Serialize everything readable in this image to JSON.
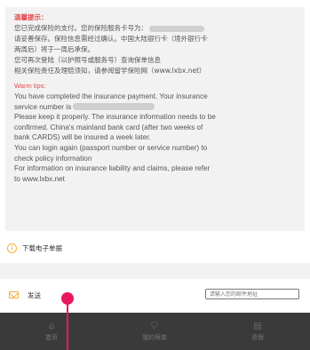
{
  "tips_cn": {
    "title": "温馨提示：",
    "lines": [
      "您已完成保险的支付。您的保险服务卡号为：",
      "请妥善保存。保险信息需经过确认。中国大陆银行卡（境外银行卡",
      "两周后）将于一周后承保。",
      "您可再次登陆（以护照号或服务号）查询保单信息",
      "相关保险责任及理赔须知，请参阅留学保险网（www.lxbx.net）"
    ]
  },
  "tips_en": {
    "title": "Warm tips:",
    "lines": [
      "You have completed the insurance payment. Your insurance",
      "service number is",
      "Please keep it properly. The insurance information needs to be",
      "confirmed. China's mainland bank card (after two weeks of",
      "bank CARDS) will be insured a week later.",
      "You can login again (passport number or service number) to",
      "check policy information",
      "For information on insurance liability and claims, please refer",
      "to www.lxbx.net"
    ]
  },
  "download": {
    "icon": "download-icon",
    "label": "下载电子单据"
  },
  "send": {
    "icon": "mail-icon",
    "label": "发送",
    "placeholder": "请输入您的邮件地址",
    "value": ""
  },
  "nav": [
    {
      "icon": "home-icon",
      "glyph": "⌂",
      "label": "首页"
    },
    {
      "icon": "shield-icon",
      "glyph": "⛉",
      "label": "我的保单"
    },
    {
      "icon": "document-icon",
      "glyph": "▤",
      "label": "退保"
    }
  ],
  "colors": {
    "accent": "#e8474c",
    "icon": "#f0b33a",
    "nav_bg": "#3a3a3a",
    "touch": "#e8175d"
  }
}
